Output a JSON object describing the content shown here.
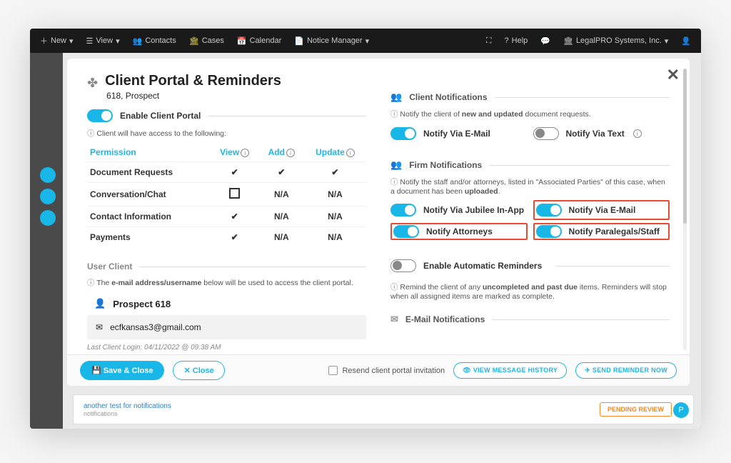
{
  "nav": {
    "new": "New",
    "view": "View",
    "contacts": "Contacts",
    "cases": "Cases",
    "calendar": "Calendar",
    "notice_manager": "Notice Manager",
    "help": "Help",
    "company": "LegalPRO Systems, Inc."
  },
  "modal": {
    "title": "Client Portal & Reminders",
    "subtitle": "618, Prospect",
    "enable_portal": "Enable Client Portal",
    "access_hint": "Client will have access to the following:",
    "perm_headers": {
      "permission": "Permission",
      "view": "View",
      "add": "Add",
      "update": "Update"
    },
    "perm_rows": [
      {
        "label": "Document Requests",
        "view": "✔",
        "add": "✔",
        "update": "✔"
      },
      {
        "label": "Conversation/Chat",
        "view": "☐",
        "add": "N/A",
        "update": "N/A"
      },
      {
        "label": "Contact Information",
        "view": "✔",
        "add": "N/A",
        "update": "N/A"
      },
      {
        "label": "Payments",
        "view": "✔",
        "add": "N/A",
        "update": "N/A"
      }
    ],
    "user_client_h": "User Client",
    "user_client_hint_a": "The ",
    "user_client_hint_b": "e-mail address/username",
    "user_client_hint_c": " below will be used to access the client portal.",
    "user_name": "Prospect 618",
    "user_email": "ecfkansas3@gmail.com",
    "last_login": "Last Client Login: 04/11/2022 @ 09:38 AM",
    "client_notif_h": "Client Notifications",
    "client_notif_hint_a": "Notify the client of ",
    "client_notif_hint_b": "new and updated",
    "client_notif_hint_c": " document requests.",
    "notify_email": "Notify Via E-Mail",
    "notify_text": "Notify Via Text",
    "firm_notif_h": "Firm Notifications",
    "firm_notif_hint_a": "Notify the staff and/or attorneys, listed in \"Associated Parties\" of this case, when a document has been ",
    "firm_notif_hint_b": "uploaded",
    "firm_notif_hint_c": ".",
    "firm_inapp": "Notify Via Jubilee In-App",
    "firm_email": "Notify Via E-Mail",
    "firm_attorneys": "Notify Attorneys",
    "firm_paralegals": "Notify Paralegals/Staff",
    "auto_rem": "Enable Automatic Reminders",
    "auto_rem_hint_a": "Remind the client of any ",
    "auto_rem_hint_b": "uncompleted and past due",
    "auto_rem_hint_c": " items. Reminders will stop when all assigned items are marked as complete.",
    "email_notif_h": "E-Mail Notifications"
  },
  "footer": {
    "save": "Save & Close",
    "close": "Close",
    "resend": "Resend client portal invitation",
    "view_history": "VIEW MESSAGE HISTORY",
    "send_now": "SEND REMINDER NOW"
  },
  "bg": {
    "card_text": "another test for notifications",
    "card_sub": "notifications",
    "pending": "PENDING REVIEW"
  }
}
